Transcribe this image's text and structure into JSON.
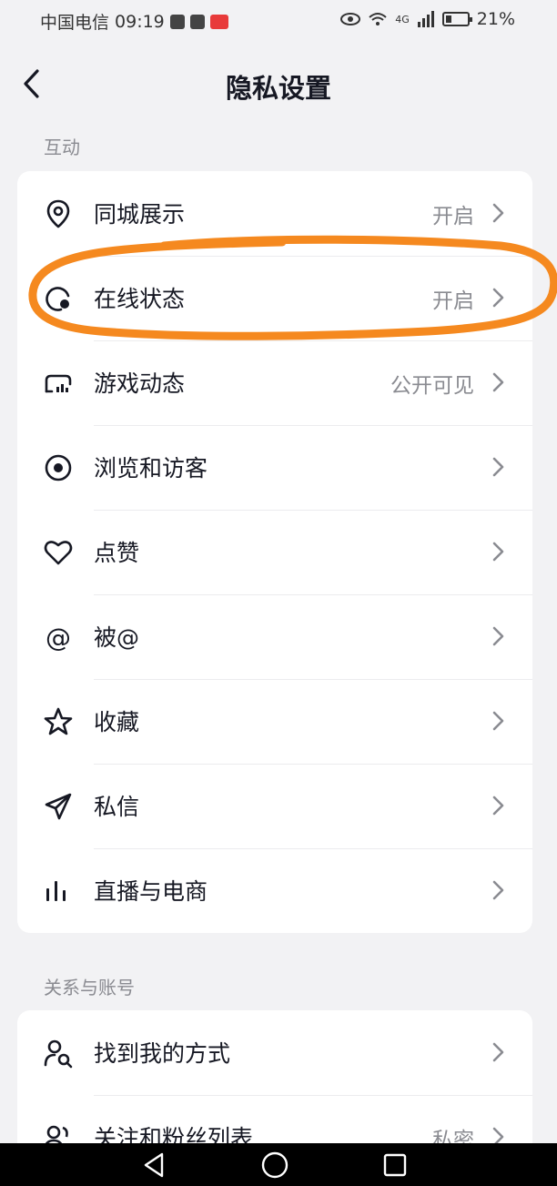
{
  "status_bar": {
    "carrier": "中国电信",
    "time": "09:19",
    "network": "4G",
    "battery": "21%"
  },
  "header": {
    "title": "隐私设置"
  },
  "section_interaction": {
    "title": "互动",
    "items": [
      {
        "label": "同城展示",
        "value": "开启",
        "icon": "location-icon"
      },
      {
        "label": "在线状态",
        "value": "开启",
        "icon": "online-status-icon"
      },
      {
        "label": "游戏动态",
        "value": "公开可见",
        "icon": "game-icon"
      },
      {
        "label": "浏览和访客",
        "value": "",
        "icon": "eye-icon"
      },
      {
        "label": "点赞",
        "value": "",
        "icon": "heart-icon"
      },
      {
        "label": "被@",
        "value": "",
        "icon": "at-icon"
      },
      {
        "label": "收藏",
        "value": "",
        "icon": "star-icon"
      },
      {
        "label": "私信",
        "value": "",
        "icon": "send-icon"
      },
      {
        "label": "直播与电商",
        "value": "",
        "icon": "bars-icon"
      }
    ]
  },
  "section_account": {
    "title": "关系与账号",
    "items": [
      {
        "label": "找到我的方式",
        "value": "",
        "icon": "find-user-icon"
      },
      {
        "label": "关注和粉丝列表",
        "value": "私密",
        "icon": "users-icon"
      }
    ]
  },
  "annotation": {
    "color": "#f5891f"
  }
}
